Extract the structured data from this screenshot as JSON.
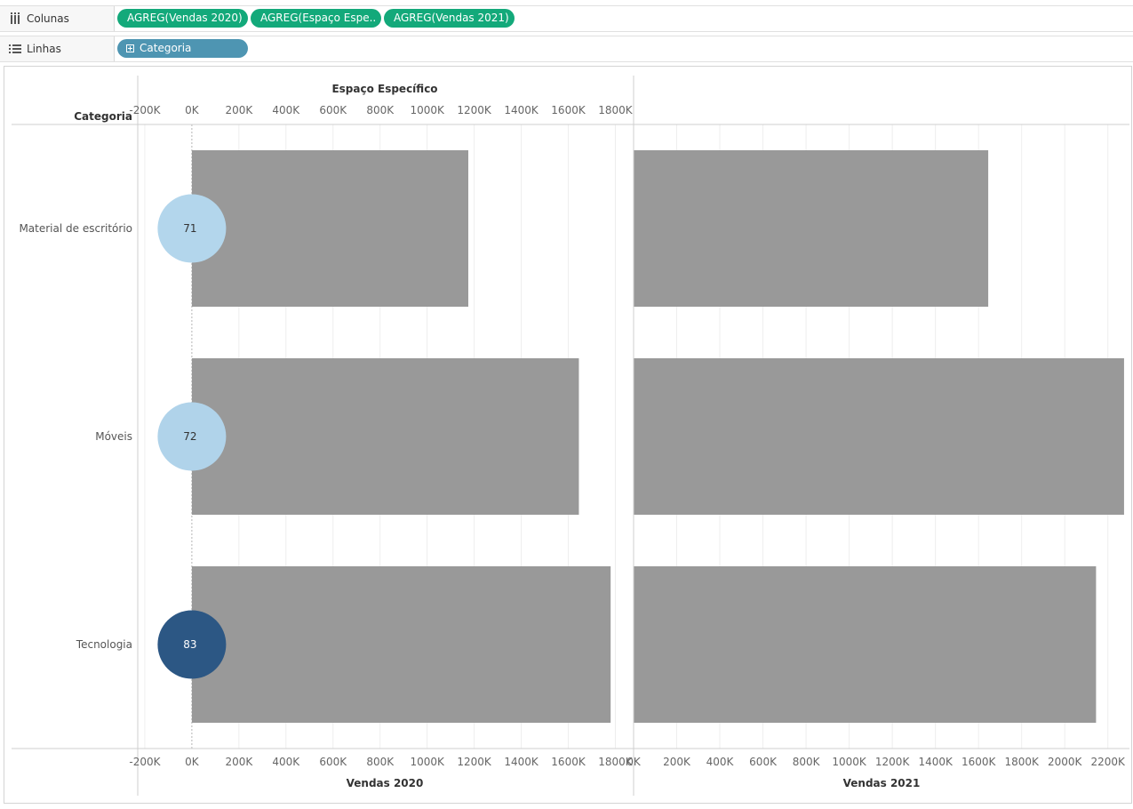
{
  "shelves": {
    "columns": {
      "label": "Colunas",
      "icon": "columns-icon",
      "pills": [
        "AGREG(Vendas 2020)",
        "AGREG(Espaço Espe..",
        "AGREG(Vendas 2021)"
      ]
    },
    "rows": {
      "label": "Linhas",
      "icon": "rows-icon",
      "pills": [
        "Categoria"
      ]
    }
  },
  "colors": {
    "pill_green": "#13a97a",
    "pill_blue": "#4e95b2",
    "bar": "#999999",
    "circle_low": "#b3d6ec",
    "circle_high": "#2c5784"
  },
  "chart_data": {
    "type": "bar",
    "row_header": "Categoria",
    "categories": [
      "Material de escritório",
      "Móveis",
      "Tecnologia"
    ],
    "panes": [
      {
        "name": "Vendas 2020",
        "xlabel": "Vendas 2020",
        "top_axis_label": "Espaço Específico",
        "xlim": [
          -230000,
          1870000
        ],
        "ticks": [
          "-200K",
          "0K",
          "200K",
          "400K",
          "600K",
          "800K",
          "1000K",
          "1200K",
          "1400K",
          "1600K",
          "1800K"
        ],
        "values": [
          1175000,
          1645000,
          1780000
        ]
      },
      {
        "name": "Vendas 2021",
        "xlabel": "Vendas 2021",
        "xlim": [
          0,
          2300000
        ],
        "ticks": [
          "0K",
          "200K",
          "400K",
          "600K",
          "800K",
          "1000K",
          "1200K",
          "1400K",
          "1600K",
          "1800K",
          "2000K",
          "2200K"
        ],
        "values": [
          1645000,
          2275000,
          2145000
        ]
      }
    ],
    "espaco_especifico": {
      "name": "Espaço Específico",
      "values": [
        71,
        72,
        83
      ]
    },
    "grid": true
  }
}
